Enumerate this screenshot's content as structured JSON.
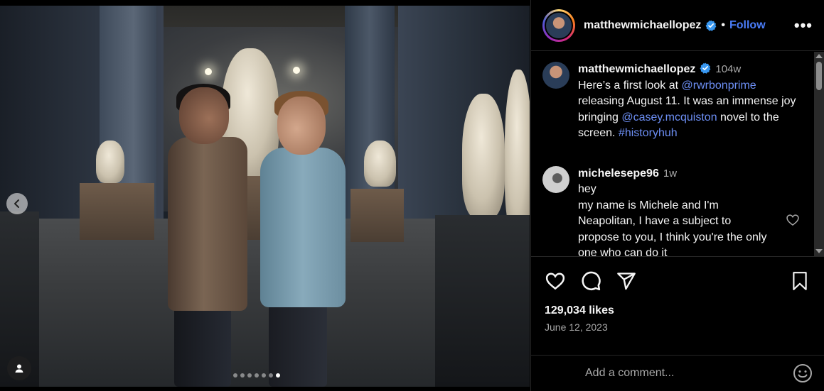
{
  "post": {
    "carousel": {
      "total_slides": 7,
      "active_index": 6
    }
  },
  "header": {
    "username": "matthewmichaellopez",
    "separator": "•",
    "follow_label": "Follow",
    "more_label": "•••"
  },
  "caption": {
    "username": "matthewmichaellopez",
    "time": "104w",
    "text_1": "Here’s a first look at ",
    "mention_1": "@rwrbonprime",
    "text_2": " releasing August 11. It was an immense joy bringing ",
    "mention_2": "@casey.mcquiston",
    "text_3": " novel to the screen. ",
    "hashtag": "#historyhuh"
  },
  "comments": [
    {
      "username": "michelesepe96",
      "time": "1w",
      "line_1": "hey",
      "line_2": "my name is Michele and I'm Neapolitan, I have a subject to propose to you, I think you're the only one who can do it"
    }
  ],
  "stats": {
    "likes": "129,034 likes",
    "date": "June 12, 2023"
  },
  "add_comment": {
    "placeholder": "Add a comment..."
  },
  "colors": {
    "accent": "#4a7cf7",
    "mention": "#6d8ff5",
    "muted": "#a8a8a8",
    "background": "#000000"
  },
  "icons": [
    "chevron-left-icon",
    "user-tag-icon",
    "verified-badge-icon",
    "more-icon",
    "heart-icon",
    "comment-icon",
    "share-icon",
    "bookmark-icon",
    "emoji-icon"
  ]
}
